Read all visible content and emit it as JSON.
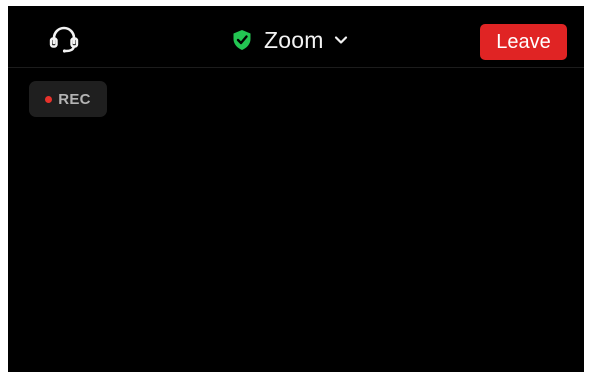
{
  "header": {
    "title": "Zoom",
    "leave_label": "Leave",
    "audio_icon": "headphones-icon",
    "security_icon": "shield-check-icon",
    "dropdown_icon": "chevron-down-icon"
  },
  "recording": {
    "label": "REC",
    "indicator_icon": "recording-dot-icon"
  },
  "colors": {
    "background": "#000000",
    "leave_button": "#e02424",
    "shield": "#23c552",
    "rec_dot": "#e8322b",
    "rec_badge": "#1f1f1f"
  }
}
